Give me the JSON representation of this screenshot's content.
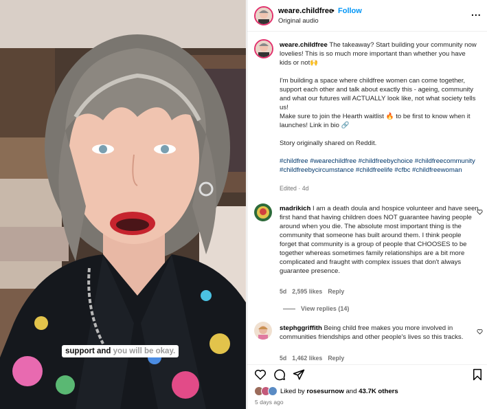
{
  "post": {
    "username": "weare.childfree",
    "separator": "•",
    "follow_label": "Follow",
    "audio": "Original audio",
    "more_label": "..."
  },
  "video": {
    "caption_dark": "support and",
    "caption_light": "you will be okay."
  },
  "caption": {
    "username": "weare.childfree",
    "line1": "The takeaway? Start building your community now lovelies! This is so much more important than whether you have kids or not🙌",
    "line2": "I'm building a space where childfree women can come together, support each other and talk about exactly this - ageing, community and what our futures will ACTUALLY look like, not what society tells us!",
    "line3": "Make sure to join the Hearth waitlist 🔥 to be first to know when it launches! Link in bio 🔗",
    "line4": "Story originally shared on Reddit.",
    "hashtags": "#childfree #wearechildfree #childfreebychoice #childfreecommunity #childfreebycircumstance #childfreelife #cfbc #childfreewoman",
    "edited": "Edited · 4d"
  },
  "comments": [
    {
      "username": "madrikich",
      "text": "I am a death doula and hospice volunteer and have seen first hand that having children does NOT guarantee having people around when you die. The absolute most important thing is the community that someone has built around them. I think people forget that community is a group of people that CHOOSES to be together whereas sometimes family relationships are a bit more complicated and fraught with complex issues that don't always guarantee presence.",
      "age": "5d",
      "likes": "2,595 likes",
      "reply": "Reply",
      "view_replies": "View replies (14)"
    },
    {
      "username": "stephggriffith",
      "text": "Being child free makes you more involved in communities friendships and other people's lives so this tracks.",
      "age": "5d",
      "likes": "1,462 likes",
      "reply": "Reply"
    }
  ],
  "footer": {
    "liked_by_prefix": "Liked by",
    "liked_by_user": "rosesurnow",
    "liked_by_and": "and",
    "liked_by_others": "43.7K others",
    "posted_ago": "5 days ago"
  },
  "icons": {
    "like": "heart-icon",
    "comment": "comment-icon",
    "share": "share-icon",
    "save": "bookmark-icon"
  },
  "colors": {
    "follow": "#0095f6",
    "hashtag": "#00376b",
    "muted": "#737373"
  }
}
